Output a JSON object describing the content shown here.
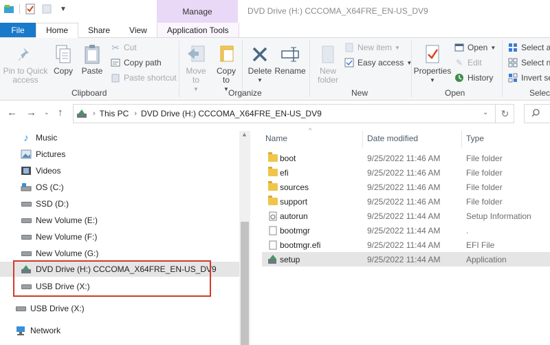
{
  "window": {
    "title": "DVD Drive (H:) CCCOMA_X64FRE_EN-US_DV9",
    "context_tab": "Manage"
  },
  "tabs": [
    "File",
    "Home",
    "Share",
    "View",
    "Application Tools"
  ],
  "ribbon": {
    "clipboard": {
      "label": "Clipboard",
      "pin": "Pin to Quick access",
      "copy": "Copy",
      "paste": "Paste",
      "cut": "Cut",
      "copy_path": "Copy path",
      "paste_shortcut": "Paste shortcut"
    },
    "organize": {
      "label": "Organize",
      "move_to": "Move to",
      "copy_to": "Copy to",
      "delete": "Delete",
      "rename": "Rename"
    },
    "new": {
      "label": "New",
      "new_folder": "New folder",
      "new_item": "New item",
      "easy_access": "Easy access"
    },
    "open": {
      "label": "Open",
      "properties": "Properties",
      "open": "Open",
      "edit": "Edit",
      "history": "History"
    },
    "select": {
      "label": "Select",
      "select_all": "Select all",
      "select_none": "Select none",
      "invert_selection": "Invert se"
    }
  },
  "address": {
    "this_pc": "This PC",
    "current": "DVD Drive (H:) CCCOMA_X64FRE_EN-US_DV9"
  },
  "nav_pane": [
    {
      "label": "Music",
      "icon": "music-icon"
    },
    {
      "label": "Pictures",
      "icon": "pictures-icon"
    },
    {
      "label": "Videos",
      "icon": "videos-icon"
    },
    {
      "label": "OS (C:)",
      "icon": "os-drive-icon"
    },
    {
      "label": "SSD (D:)",
      "icon": "drive-icon"
    },
    {
      "label": "New Volume (E:)",
      "icon": "drive-icon"
    },
    {
      "label": "New Volume (F:)",
      "icon": "drive-icon"
    },
    {
      "label": "New Volume (G:)",
      "icon": "drive-icon"
    },
    {
      "label": "DVD Drive (H:) CCCOMA_X64FRE_EN-US_DV9",
      "icon": "dvd-drive-icon",
      "selected": true
    },
    {
      "label": "USB Drive (X:)",
      "icon": "usb-drive-icon"
    },
    {
      "label": "USB Drive (X:)",
      "icon": "usb-drive-icon"
    },
    {
      "label": "Network",
      "icon": "network-icon"
    }
  ],
  "columns": {
    "name": "Name",
    "date": "Date modified",
    "type": "Type"
  },
  "files": [
    {
      "name": "boot",
      "date": "9/25/2022 11:46 AM",
      "type": "File folder",
      "icon": "folder-icon"
    },
    {
      "name": "efi",
      "date": "9/25/2022 11:46 AM",
      "type": "File folder",
      "icon": "folder-icon"
    },
    {
      "name": "sources",
      "date": "9/25/2022 11:46 AM",
      "type": "File folder",
      "icon": "folder-icon"
    },
    {
      "name": "support",
      "date": "9/25/2022 11:46 AM",
      "type": "File folder",
      "icon": "folder-icon"
    },
    {
      "name": "autorun",
      "date": "9/25/2022 11:44 AM",
      "type": "Setup Information",
      "icon": "setup-info-icon"
    },
    {
      "name": "bootmgr",
      "date": "9/25/2022 11:44 AM",
      "type": ".",
      "icon": "file-icon"
    },
    {
      "name": "bootmgr.efi",
      "date": "9/25/2022 11:44 AM",
      "type": "EFI File",
      "icon": "file-icon"
    },
    {
      "name": "setup",
      "date": "9/25/2022 11:44 AM",
      "type": "Application",
      "icon": "setup-app-icon",
      "selected": true
    }
  ]
}
